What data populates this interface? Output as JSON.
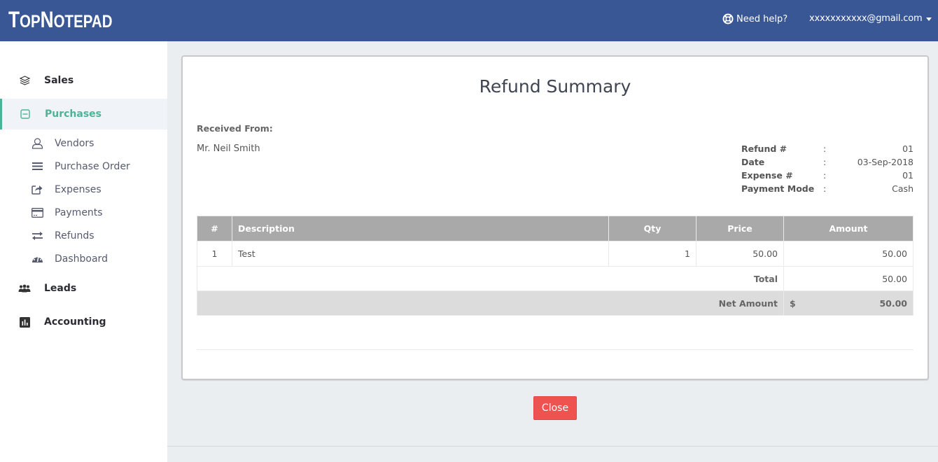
{
  "app": {
    "logo_first": "T",
    "logo_rest1": "OP",
    "logo_mid": "N",
    "logo_rest2": "OTEPAD",
    "brand_color": "#3a5795",
    "accent_color": "#4db398"
  },
  "header": {
    "help_icon": "life-ring-icon",
    "help_label": "Need help?",
    "user_email": "xxxxxxxxxxx@gmail.com",
    "user_menu_icon": "caret-down-icon"
  },
  "sidebar": {
    "sections": [
      {
        "label": "Sales",
        "icon": "layers-icon",
        "active": false
      },
      {
        "label": "Purchases",
        "icon": "minus-square-icon",
        "active": true,
        "items": [
          {
            "label": "Vendors",
            "icon": "user-icon"
          },
          {
            "label": "Purchase Order",
            "icon": "bars-icon"
          },
          {
            "label": "Expenses",
            "icon": "share-square-icon"
          },
          {
            "label": "Payments",
            "icon": "credit-card-icon"
          },
          {
            "label": "Refunds",
            "icon": "exchange-icon"
          },
          {
            "label": "Dashboard",
            "icon": "dashboard-icon"
          }
        ]
      },
      {
        "label": "Leads",
        "icon": "users-icon",
        "active": false
      },
      {
        "label": "Accounting",
        "icon": "bar-chart-icon",
        "active": false
      }
    ]
  },
  "summary": {
    "title": "Refund Summary",
    "received_from_label": "Received From:",
    "received_from_name": "Mr. Neil Smith",
    "meta": [
      {
        "key": "Refund #",
        "sep": ":",
        "value": "01"
      },
      {
        "key": "Date",
        "sep": ":",
        "value": "03-Sep-2018"
      },
      {
        "key": "Expense #",
        "sep": ":",
        "value": "01"
      },
      {
        "key": "Payment Mode",
        "sep": ":",
        "value": "Cash"
      }
    ],
    "table": {
      "headers": [
        "#",
        "Description",
        "Qty",
        "Price",
        "Amount"
      ],
      "rows": [
        {
          "num": "1",
          "description": "Test",
          "qty": "1",
          "price": "50.00",
          "amount": "50.00"
        }
      ],
      "total_label": "Total",
      "total_value": "50.00",
      "net_label": "Net Amount",
      "net_currency": "$",
      "net_value": "50.00"
    }
  },
  "actions": {
    "close_label": "Close",
    "close_color": "#ef5350"
  }
}
